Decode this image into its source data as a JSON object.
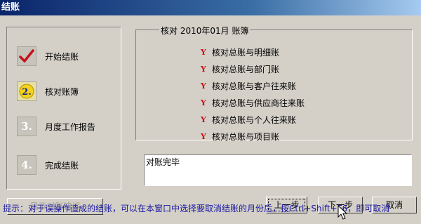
{
  "window": {
    "title": "结账"
  },
  "steps": [
    {
      "label": "开始结账",
      "icon": "checkmark-icon",
      "number": ""
    },
    {
      "label": "核对账簿",
      "icon": "step-2-icon",
      "number": "2."
    },
    {
      "label": "月度工作报告",
      "icon": "step-3-icon",
      "number": "3."
    },
    {
      "label": "完成结账",
      "icon": "step-4-icon",
      "number": "4."
    }
  ],
  "check_group": {
    "legend": "核对 2010年01月 账簿",
    "marker": "Y",
    "items": [
      "核对总账与明细账",
      "核对总账与部门账",
      "核对总账与客户往来账",
      "核对总账与供应商往来账",
      "核对总账与个人往来账",
      "核对总账与项目账"
    ]
  },
  "result_text": "对账完毕",
  "buttons": {
    "show_errors": "显示对账错误",
    "prev": "上一步",
    "next": "下一步",
    "cancel": "取消"
  },
  "hint": "提示：对于误操作造成的结账，可以在本窗口中选择要取消结账的月份后，按Ctrl+Shift+F6，即可取消"
}
